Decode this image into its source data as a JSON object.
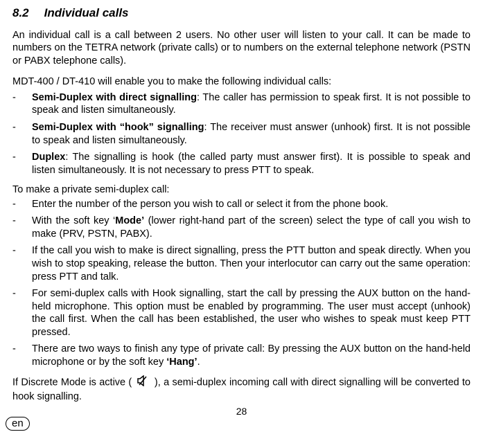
{
  "heading": {
    "number": "8.2",
    "title": "Individual calls"
  },
  "intro": "An individual call is a call between 2 users. No other user will listen to your call. It can be made to numbers on the TETRA network (private calls) or to numbers on the external telephone network (PSTN or PABX telephone calls).",
  "models_intro": "MDT-400 / DT-410 will enable you to make the following individual calls:",
  "bullets1": [
    {
      "term": "Semi-Duplex with direct signalling",
      "rest": ": The caller has permission to speak first. It is not possible to speak and listen simultaneously."
    },
    {
      "term": "Semi-Duplex with “hook” signalling",
      "rest": ": The receiver must answer (unhook) first. It is not possible to speak and listen simultaneously."
    },
    {
      "term": "Duplex",
      "rest": ": The signalling is hook (the called party must answer first). It is possible to speak and listen simultaneously. It is not necessary to press PTT to speak."
    }
  ],
  "howto_intro": "To make a private semi-duplex call:",
  "bullets2": [
    {
      "pre": "Enter the number of the person you wish to call or select it from the phone book."
    },
    {
      "pre": "With the soft key ‘",
      "bold": "Mode’",
      "post": " (lower right-hand part of the screen) select the type of call you wish to make (PRV, PSTN, PABX)."
    },
    {
      "pre": "If the call you wish to make is direct signalling, press the PTT button and speak directly. When you wish to stop speaking, release the button. Then your interlocutor can carry out the same operation: press PTT and talk."
    },
    {
      "pre": "For semi-duplex calls with Hook signalling, start the call by pressing the AUX button on the hand-held microphone. This option must be enabled by programming. The user must accept (unhook) the call first. When the call has been established, the user who wishes to speak must keep PTT pressed."
    },
    {
      "pre": "There are two ways to finish any type of private call: By pressing the AUX button on the hand-held microphone or by the soft key ",
      "bold": "‘Hang’",
      "post": "."
    }
  ],
  "discrete_pre": "If Discrete Mode is active ( ",
  "discrete_post": " ), a semi-duplex incoming call with direct signalling will be converted to hook signalling.",
  "icons": {
    "discrete": "speaker-muted-icon"
  },
  "page_number": "28",
  "lang_badge": "en"
}
